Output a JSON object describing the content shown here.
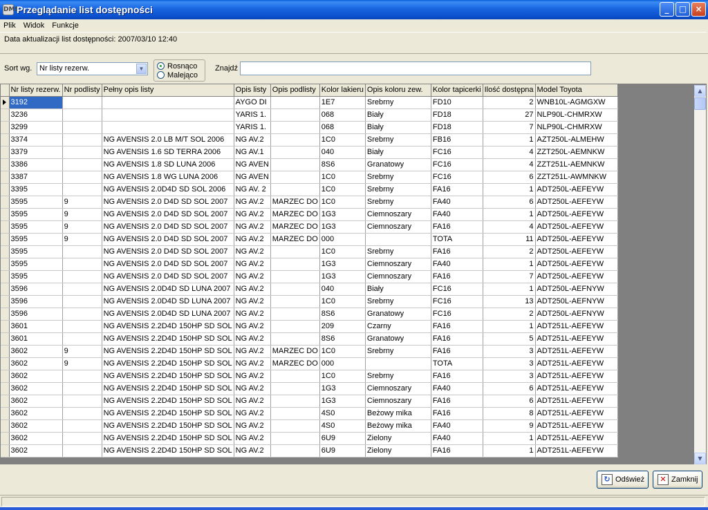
{
  "window": {
    "title": "Przeglądanie list dostępności",
    "icon_text": "DMS",
    "minimize": "_",
    "maximize": "□",
    "close": "×"
  },
  "menu": [
    "Plik",
    "Widok",
    "Funkcje"
  ],
  "info": {
    "update_text": "Data aktualizacji list dostępności: 2007/03/10 12:40"
  },
  "sort": {
    "label": "Sort wg.",
    "selected": "Nr listy rezerw.",
    "asc_label": "Rosnąco",
    "desc_label": "Malejąco",
    "asc_checked": true
  },
  "find": {
    "label": "Znajdź",
    "value": ""
  },
  "columns": [
    "Nr listy rezerw.",
    "Nr podlisty",
    "Pełny opis listy",
    "Opis listy",
    "Opis podlisty",
    "Kolor lakieru",
    "Opis koloru zew.",
    "Kolor tapicerki",
    "Ilość dostępna",
    "Model Toyota"
  ],
  "rows": [
    [
      "3192",
      "",
      "",
      "AYGO DI",
      "",
      "1E7",
      "Srebrny",
      "FD10",
      "2",
      "WNB10L-AGMGXW"
    ],
    [
      "3236",
      "",
      "",
      "YARIS 1.",
      "",
      "068",
      "Biały",
      "FD18",
      "27",
      "NLP90L-CHMRXW"
    ],
    [
      "3299",
      "",
      "",
      "YARIS 1.",
      "",
      "068",
      "Biały",
      "FD18",
      "7",
      "NLP90L-CHMRXW"
    ],
    [
      "3374",
      "",
      "NG AVENSIS 2.0 LB M/T SOL 2006",
      "NG AV.2",
      "",
      "1C0",
      "Srebrny",
      "FB16",
      "1",
      "AZT250L-ALMEHW"
    ],
    [
      "3379",
      "",
      "NG AVENSIS 1.6 SD TERRA 2006",
      "NG AV.1",
      "",
      "040",
      "Biały",
      "FC16",
      "4",
      "ZZT250L-AEMNKW"
    ],
    [
      "3386",
      "",
      "NG AVENSIS 1.8 SD LUNA 2006",
      "NG AVEN",
      "",
      "8S6",
      "Granatowy",
      "FC16",
      "4",
      "ZZT251L-AEMNKW"
    ],
    [
      "3387",
      "",
      "NG AVENSIS 1.8 WG LUNA 2006",
      "NG AVEN",
      "",
      "1C0",
      "Srebrny",
      "FC16",
      "6",
      "ZZT251L-AWMNKW"
    ],
    [
      "3395",
      "",
      "NG AVENSIS 2.0D4D SD SOL 2006",
      "NG AV. 2",
      "",
      "1C0",
      "Srebrny",
      "FA16",
      "1",
      "ADT250L-AEFEYW"
    ],
    [
      "3595",
      "9",
      "NG AVENSIS 2.0 D4D SD SOL 2007",
      "NG AV.2",
      "MARZEC DO",
      "1C0",
      "Srebrny",
      "FA40",
      "6",
      "ADT250L-AEFEYW"
    ],
    [
      "3595",
      "9",
      "NG AVENSIS 2.0 D4D SD SOL 2007",
      "NG AV.2",
      "MARZEC DO",
      "1G3",
      "Ciemnoszary",
      "FA40",
      "1",
      "ADT250L-AEFEYW"
    ],
    [
      "3595",
      "9",
      "NG AVENSIS 2.0 D4D SD SOL 2007",
      "NG AV.2",
      "MARZEC DO",
      "1G3",
      "Ciemnoszary",
      "FA16",
      "4",
      "ADT250L-AEFEYW"
    ],
    [
      "3595",
      "9",
      "NG AVENSIS 2.0 D4D SD SOL 2007",
      "NG AV.2",
      "MARZEC DO",
      "000",
      "",
      "TOTA",
      "11",
      "ADT250L-AEFEYW"
    ],
    [
      "3595",
      "",
      "NG AVENSIS 2.0 D4D SD SOL 2007",
      "NG AV.2",
      "",
      "1C0",
      "Srebrny",
      "FA16",
      "2",
      "ADT250L-AEFEYW"
    ],
    [
      "3595",
      "",
      "NG AVENSIS 2.0 D4D SD SOL 2007",
      "NG AV.2",
      "",
      "1G3",
      "Ciemnoszary",
      "FA40",
      "1",
      "ADT250L-AEFEYW"
    ],
    [
      "3595",
      "",
      "NG AVENSIS 2.0 D4D SD SOL 2007",
      "NG AV.2",
      "",
      "1G3",
      "Ciemnoszary",
      "FA16",
      "7",
      "ADT250L-AEFEYW"
    ],
    [
      "3596",
      "",
      "NG AVENSIS 2.0D4D SD LUNA 2007",
      "NG AV.2",
      "",
      "040",
      "Biały",
      "FC16",
      "1",
      "ADT250L-AEFNYW"
    ],
    [
      "3596",
      "",
      "NG AVENSIS 2.0D4D SD LUNA 2007",
      "NG AV.2",
      "",
      "1C0",
      "Srebrny",
      "FC16",
      "13",
      "ADT250L-AEFNYW"
    ],
    [
      "3596",
      "",
      "NG AVENSIS 2.0D4D SD LUNA 2007",
      "NG AV.2",
      "",
      "8S6",
      "Granatowy",
      "FC16",
      "2",
      "ADT250L-AEFNYW"
    ],
    [
      "3601",
      "",
      "NG AVENSIS 2.2D4D 150HP SD SOL",
      "NG AV.2",
      "",
      "209",
      "Czarny",
      "FA16",
      "1",
      "ADT251L-AEFEYW"
    ],
    [
      "3601",
      "",
      "NG AVENSIS 2.2D4D 150HP SD SOL",
      "NG AV.2",
      "",
      "8S6",
      "Granatowy",
      "FA16",
      "5",
      "ADT251L-AEFEYW"
    ],
    [
      "3602",
      "9",
      "NG AVENSIS 2.2D4D 150HP SD SOL",
      "NG AV.2",
      "MARZEC DO",
      "1C0",
      "Srebrny",
      "FA16",
      "3",
      "ADT251L-AEFEYW"
    ],
    [
      "3602",
      "9",
      "NG AVENSIS 2.2D4D 150HP SD SOL",
      "NG AV.2",
      "MARZEC DO",
      "000",
      "",
      "TOTA",
      "3",
      "ADT251L-AEFEYW"
    ],
    [
      "3602",
      "",
      "NG AVENSIS 2.2D4D 150HP SD SOL",
      "NG AV.2",
      "",
      "1C0",
      "Srebrny",
      "FA16",
      "3",
      "ADT251L-AEFEYW"
    ],
    [
      "3602",
      "",
      "NG AVENSIS 2.2D4D 150HP SD SOL",
      "NG AV.2",
      "",
      "1G3",
      "Ciemnoszary",
      "FA40",
      "6",
      "ADT251L-AEFEYW"
    ],
    [
      "3602",
      "",
      "NG AVENSIS 2.2D4D 150HP SD SOL",
      "NG AV.2",
      "",
      "1G3",
      "Ciemnoszary",
      "FA16",
      "6",
      "ADT251L-AEFEYW"
    ],
    [
      "3602",
      "",
      "NG AVENSIS 2.2D4D 150HP SD SOL",
      "NG AV.2",
      "",
      "4S0",
      "Beżowy mika",
      "FA16",
      "8",
      "ADT251L-AEFEYW"
    ],
    [
      "3602",
      "",
      "NG AVENSIS 2.2D4D 150HP SD SOL",
      "NG AV.2",
      "",
      "4S0",
      "Beżowy mika",
      "FA40",
      "9",
      "ADT251L-AEFEYW"
    ],
    [
      "3602",
      "",
      "NG AVENSIS 2.2D4D 150HP SD SOL",
      "NG AV.2",
      "",
      "6U9",
      "Zielony",
      "FA40",
      "1",
      "ADT251L-AEFEYW"
    ],
    [
      "3602",
      "",
      "NG AVENSIS 2.2D4D 150HP SD SOL",
      "NG AV.2",
      "",
      "6U9",
      "Zielony",
      "FA16",
      "1",
      "ADT251L-AEFEYW"
    ]
  ],
  "buttons": {
    "refresh": "Odśwież",
    "close": "Zamknij"
  },
  "colors": {
    "selection": "#316ac5",
    "titlebar": "#0b4fcc",
    "face": "#ece9d8"
  }
}
